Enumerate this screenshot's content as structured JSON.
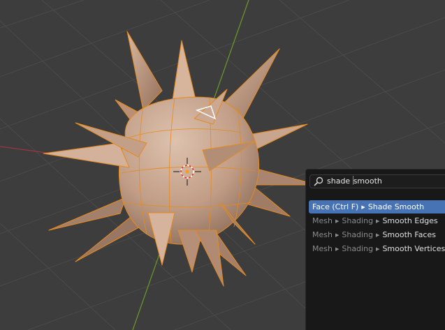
{
  "search": {
    "query_before_caret": "shade ",
    "query_after_caret": "smooth"
  },
  "results": [
    {
      "path": [
        "Face (Ctrl F)"
      ],
      "name": "Shade Smooth",
      "active": true
    },
    {
      "path": [
        "Mesh",
        "Shading"
      ],
      "name": "Smooth Edges",
      "active": false
    },
    {
      "path": [
        "Mesh",
        "Shading"
      ],
      "name": "Smooth Faces",
      "active": false
    },
    {
      "path": [
        "Mesh",
        "Shading"
      ],
      "name": "Smooth Vertices",
      "active": false
    }
  ],
  "colors": {
    "viewport_bg": "#3d3d3d",
    "grid": "#474747",
    "x_axis": "#a03a48",
    "y_axis": "#6f9a2c",
    "mesh_fill": "#c9a28a",
    "mesh_edge": "#e6831a",
    "highlight": "#4772b3"
  },
  "icons": {
    "search": "search-icon",
    "crosshair": "3d-cursor-icon"
  }
}
